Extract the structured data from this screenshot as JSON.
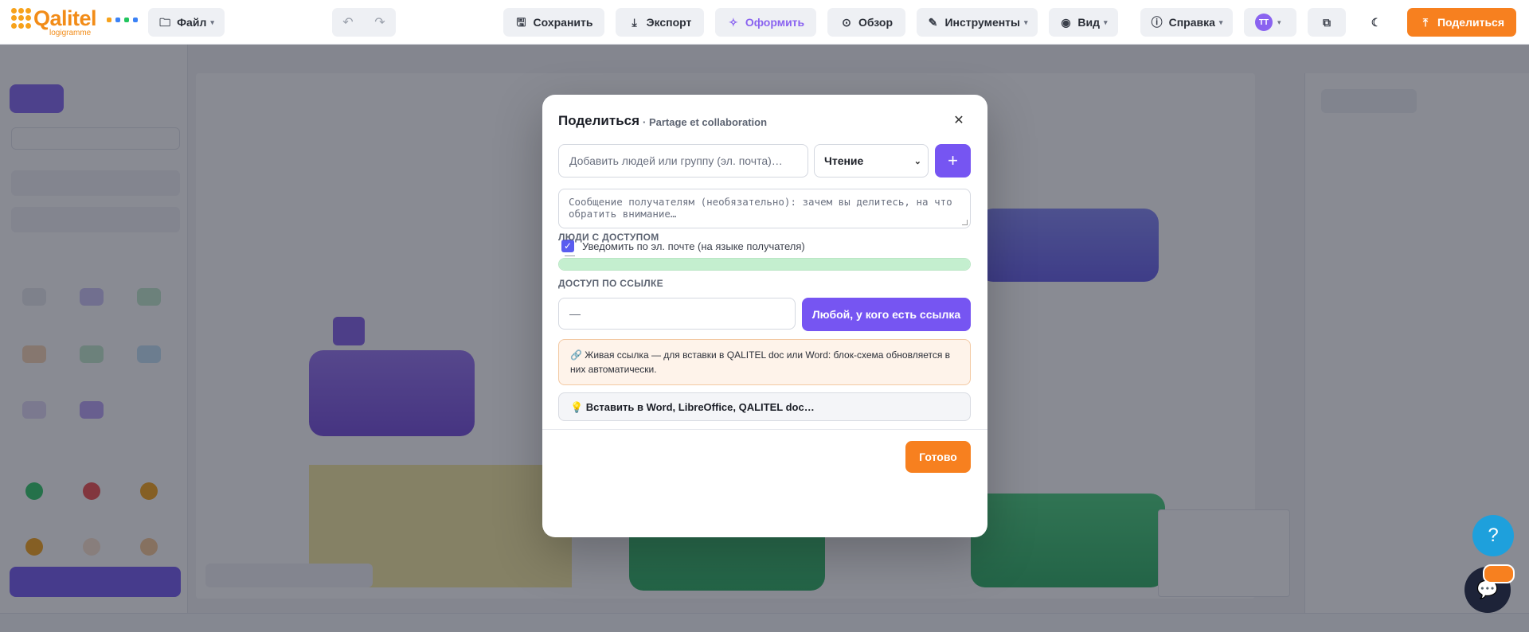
{
  "brand": {
    "name": "Qalitel",
    "subtitle": "logigramme",
    "primary_color": "#f28c18"
  },
  "toolbar": {
    "file_label": "Файл",
    "save_label": "Сохранить",
    "export_label": "Экспорт",
    "design_label": "Оформить",
    "review_label": "Обзор",
    "tools_label": "Инструменты",
    "view_label": "Вид",
    "help_label": "Справка",
    "avatar_initials": "TT",
    "share_label": "Поделиться"
  },
  "share_dialog": {
    "title": "Поделиться",
    "subtitle": "· Partage et collaboration",
    "add_people_placeholder": "Добавить людей или группу (эл. почта)…",
    "permission_selected": "Чтение",
    "add_button_label": "+",
    "message_placeholder": "Сообщение получателям (необязательно): зачем вы делитесь, на что обратить внимание…",
    "notify_label": "Уведомить по эл. почте (на языке получателя)",
    "notify_checked": true,
    "people_section_label": "ЛЮДИ С ДОСТУПОМ",
    "people_empty": "—",
    "link_section_label": "ДОСТУП ПО ССЫЛКЕ",
    "link_value": "—",
    "link_access_label": "Любой, у кого есть ссылка",
    "live_link_info": "🔗 Живая ссылка — для вставки в QALITEL doc или Word: блок-схема обновляется в них автоматически.",
    "embed_tip": "💡 Вставить в Word, LibreOffice, QALITEL doc…",
    "done_label": "Готово",
    "accent_color": "#7655f2",
    "action_color": "#f7801f"
  },
  "floating": {
    "help_label": "?"
  }
}
